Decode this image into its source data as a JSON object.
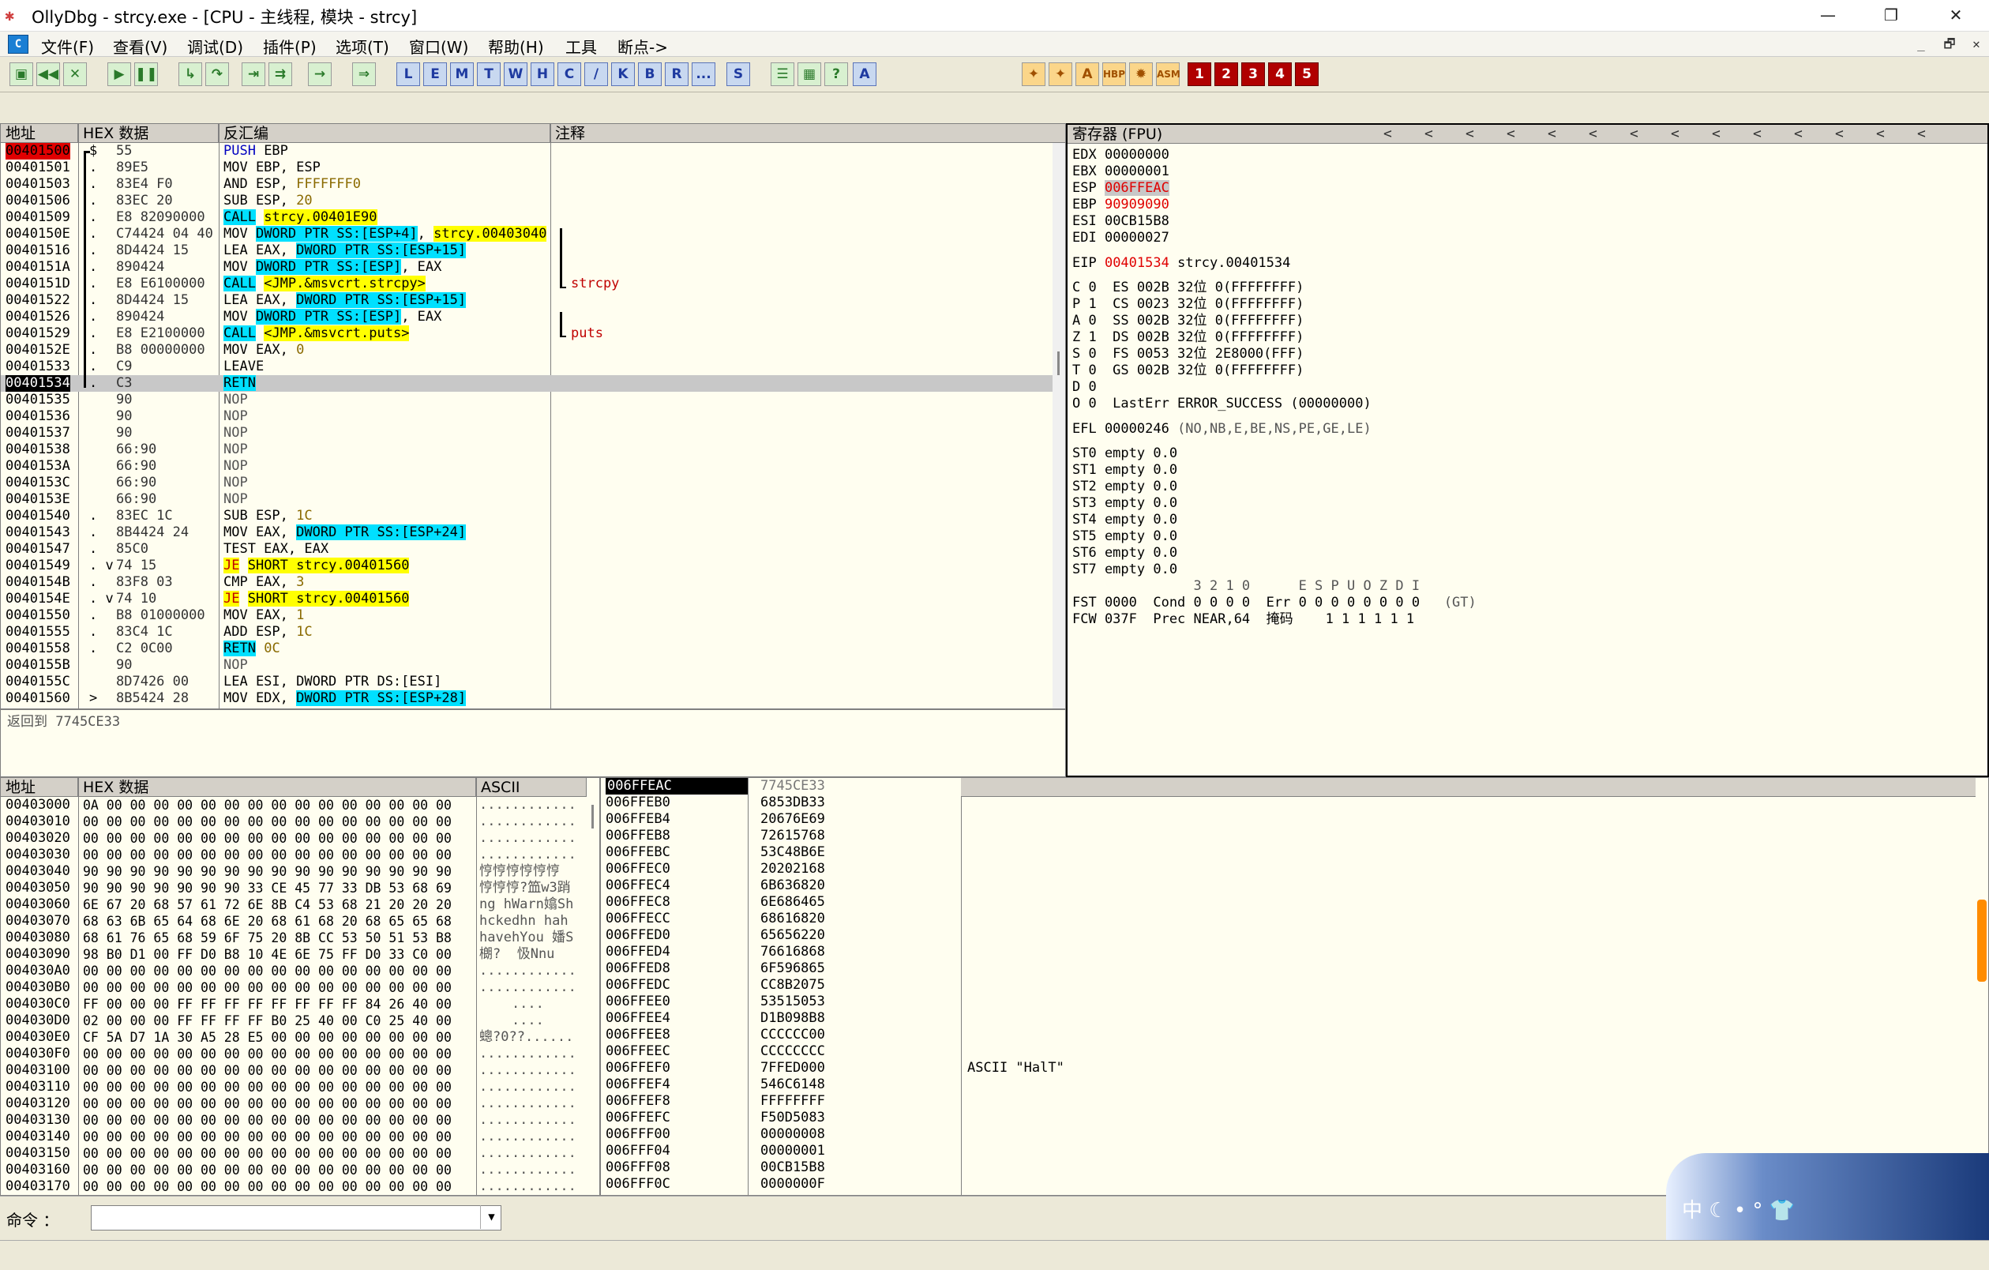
{
  "window": {
    "title": "OllyDbg - strcy.exe - [CPU -  主线程, 模块 - strcy]",
    "min_label": "—",
    "restore_label": "❐",
    "close_label": "✕"
  },
  "menu": {
    "icon": "C",
    "items": [
      "文件(F)",
      "查看(V)",
      "调试(D)",
      "插件(P)",
      "选项(T)",
      "窗口(W)",
      "帮助(H)",
      "工具",
      "断点->"
    ],
    "mdi_buttons": [
      "_",
      "🗗",
      "✕"
    ]
  },
  "toolbar": {
    "letters": [
      "L",
      "E",
      "M",
      "T",
      "W",
      "H",
      "C",
      "/",
      "K",
      "B",
      "R",
      "...",
      "S"
    ],
    "right_text": [
      "HBP",
      "ASM"
    ],
    "numbers": [
      "1",
      "2",
      "3",
      "4",
      "5"
    ]
  },
  "disasm": {
    "headers": {
      "addr": "地址",
      "hex": "HEX 数据",
      "disasm": "反汇编",
      "comment": "注释"
    },
    "rows": [
      {
        "addr": "00401500",
        "m": "$",
        "hex": "55",
        "asm": "PUSH EBP",
        "cmt": "",
        "style": "eipred"
      },
      {
        "addr": "00401501",
        "m": ".",
        "hex": "89E5",
        "asm": "MOV EBP, ESP",
        "cmt": ""
      },
      {
        "addr": "00401503",
        "m": ".",
        "hex": "83E4 F0",
        "asm": "AND ESP, FFFFFFF0",
        "cmt": ""
      },
      {
        "addr": "00401506",
        "m": ".",
        "hex": "83EC 20",
        "asm": "SUB ESP, 20",
        "cmt": ""
      },
      {
        "addr": "00401509",
        "m": ".",
        "hex": "E8 82090000",
        "asm": "CALL strcy.00401E90",
        "cmt": ""
      },
      {
        "addr": "0040150E",
        "m": ".",
        "hex": "C74424 04 40",
        "asm": "MOV DWORD PTR SS:[ESP+4], strcy.00403040",
        "cmt": ""
      },
      {
        "addr": "00401516",
        "m": ".",
        "hex": "8D4424 15",
        "asm": "LEA EAX, DWORD PTR SS:[ESP+15]",
        "cmt": ""
      },
      {
        "addr": "0040151A",
        "m": ".",
        "hex": "890424",
        "asm": "MOV DWORD PTR SS:[ESP], EAX",
        "cmt": ""
      },
      {
        "addr": "0040151D",
        "m": ".",
        "hex": "E8 E6100000",
        "asm": "CALL <JMP.&msvcrt.strcpy>",
        "cmt": "strcpy"
      },
      {
        "addr": "00401522",
        "m": ".",
        "hex": "8D4424 15",
        "asm": "LEA EAX, DWORD PTR SS:[ESP+15]",
        "cmt": ""
      },
      {
        "addr": "00401526",
        "m": ".",
        "hex": "890424",
        "asm": "MOV DWORD PTR SS:[ESP], EAX",
        "cmt": ""
      },
      {
        "addr": "00401529",
        "m": ".",
        "hex": "E8 E2100000",
        "asm": "CALL <JMP.&msvcrt.puts>",
        "cmt": "puts"
      },
      {
        "addr": "0040152E",
        "m": ".",
        "hex": "B8 00000000",
        "asm": "MOV EAX, 0",
        "cmt": ""
      },
      {
        "addr": "00401533",
        "m": ".",
        "hex": "C9",
        "asm": "LEAVE",
        "cmt": ""
      },
      {
        "addr": "00401534",
        "m": ".",
        "hex": "C3",
        "asm": "RETN",
        "cmt": "",
        "style": "cur"
      },
      {
        "addr": "00401535",
        "m": "",
        "hex": "90",
        "asm": "NOP",
        "cmt": ""
      },
      {
        "addr": "00401536",
        "m": "",
        "hex": "90",
        "asm": "NOP",
        "cmt": ""
      },
      {
        "addr": "00401537",
        "m": "",
        "hex": "90",
        "asm": "NOP",
        "cmt": ""
      },
      {
        "addr": "00401538",
        "m": "",
        "hex": "66:90",
        "asm": "NOP",
        "cmt": ""
      },
      {
        "addr": "0040153A",
        "m": "",
        "hex": "66:90",
        "asm": "NOP",
        "cmt": ""
      },
      {
        "addr": "0040153C",
        "m": "",
        "hex": "66:90",
        "asm": "NOP",
        "cmt": ""
      },
      {
        "addr": "0040153E",
        "m": "",
        "hex": "66:90",
        "asm": "NOP",
        "cmt": ""
      },
      {
        "addr": "00401540",
        "m": ".",
        "hex": "83EC 1C",
        "asm": "SUB ESP, 1C",
        "cmt": ""
      },
      {
        "addr": "00401543",
        "m": ".",
        "hex": "8B4424 24",
        "asm": "MOV EAX, DWORD PTR SS:[ESP+24]",
        "cmt": ""
      },
      {
        "addr": "00401547",
        "m": ".",
        "hex": "85C0",
        "asm": "TEST EAX, EAX",
        "cmt": ""
      },
      {
        "addr": "00401549",
        "m": ". v",
        "hex": "74 15",
        "asm": "JE SHORT strcy.00401560",
        "cmt": ""
      },
      {
        "addr": "0040154B",
        "m": ".",
        "hex": "83F8 03",
        "asm": "CMP EAX, 3",
        "cmt": ""
      },
      {
        "addr": "0040154E",
        "m": ". v",
        "hex": "74 10",
        "asm": "JE SHORT strcy.00401560",
        "cmt": ""
      },
      {
        "addr": "00401550",
        "m": ".",
        "hex": "B8 01000000",
        "asm": "MOV EAX, 1",
        "cmt": ""
      },
      {
        "addr": "00401555",
        "m": ".",
        "hex": "83C4 1C",
        "asm": "ADD ESP, 1C",
        "cmt": ""
      },
      {
        "addr": "00401558",
        "m": ".",
        "hex": "C2 0C00",
        "asm": "RETN 0C",
        "cmt": ""
      },
      {
        "addr": "0040155B",
        "m": "",
        "hex": "90",
        "asm": "NOP",
        "cmt": ""
      },
      {
        "addr": "0040155C",
        "m": "",
        "hex": "8D7426 00",
        "asm": "LEA ESI, DWORD PTR DS:[ESI]",
        "cmt": ""
      },
      {
        "addr": "00401560",
        "m": ">",
        "hex": "8B5424 28",
        "asm": "MOV EDX, DWORD PTR SS:[ESP+28]",
        "cmt": ""
      }
    ],
    "info": "返回到 7745CE33"
  },
  "registers": {
    "header": "寄存器 (FPU)",
    "arrows": [
      "<",
      "<",
      "<",
      "<",
      "<",
      "<",
      "<",
      "<",
      "<",
      "<",
      "<",
      "<",
      "<",
      "<"
    ],
    "gp": [
      {
        "name": "EDX",
        "val": "00000000",
        "extra": ""
      },
      {
        "name": "EBX",
        "val": "00000001",
        "extra": ""
      },
      {
        "name": "ESP",
        "val": "006FFEAC",
        "extra": "",
        "changed": true,
        "sel": true
      },
      {
        "name": "EBP",
        "val": "90909090",
        "extra": "",
        "changed": true
      },
      {
        "name": "ESI",
        "val": "00CB15B8",
        "extra": ""
      },
      {
        "name": "EDI",
        "val": "00000027",
        "extra": ""
      }
    ],
    "eip": {
      "name": "EIP",
      "val": "00401534",
      "extra": "strcy.00401534"
    },
    "flags": [
      "C 0  ES 002B 32位 0(FFFFFFFF)",
      "P 1  CS 0023 32位 0(FFFFFFFF)",
      "A 0  SS 002B 32位 0(FFFFFFFF)",
      "Z 1  DS 002B 32位 0(FFFFFFFF)",
      "S 0  FS 0053 32位 2E8000(FFF)",
      "T 0  GS 002B 32位 0(FFFFFFFF)",
      "D 0",
      "O 0  LastErr ERROR_SUCCESS (00000000)"
    ],
    "efl": {
      "label": "EFL 00000246",
      "extra": "(NO,NB,E,BE,NS,PE,GE,LE)"
    },
    "st": [
      "ST0 empty 0.0",
      "ST1 empty 0.0",
      "ST2 empty 0.0",
      "ST3 empty 0.0",
      "ST4 empty 0.0",
      "ST5 empty 0.0",
      "ST6 empty 0.0",
      "ST7 empty 0.0"
    ],
    "fpu_hdr": "               3 2 1 0      E S P U O Z D I",
    "fst": "FST 0000  Cond 0 0 0 0  Err 0 0 0 0 0 0 0 0",
    "fst_gt": "(GT)",
    "fcw": "FCW 037F  Prec NEAR,64  掩码    1 1 1 1 1 1"
  },
  "dump": {
    "headers": {
      "addr": "地址",
      "hex": "HEX 数据",
      "ascii": "ASCII"
    },
    "rows": [
      {
        "addr": "00403000",
        "hex": "0A 00 00 00 00 00 00 00 00 00 00 00 00 00 00 00",
        "ascii": "............"
      },
      {
        "addr": "00403010",
        "hex": "00 00 00 00 00 00 00 00 00 00 00 00 00 00 00 00",
        "ascii": "............"
      },
      {
        "addr": "00403020",
        "hex": "00 00 00 00 00 00 00 00 00 00 00 00 00 00 00 00",
        "ascii": "............"
      },
      {
        "addr": "00403030",
        "hex": "00 00 00 00 00 00 00 00 00 00 00 00 00 00 00 00",
        "ascii": "............"
      },
      {
        "addr": "00403040",
        "hex": "90 90 90 90 90 90 90 90 90 90 90 90 90 90 90 90",
        "ascii": "悙悙悙悙悙悙"
      },
      {
        "addr": "00403050",
        "hex": "90 90 90 90 90 90 90 33 CE 45 77 33 DB 53 68 69",
        "ascii": "悙悙悙?笽w3踃"
      },
      {
        "addr": "00403060",
        "hex": "6E 67 20 68 57 61 72 6E 8B C4 53 68 21 20 20 20",
        "ascii": "ng hWarn嬆Sh"
      },
      {
        "addr": "00403070",
        "hex": "68 63 6B 65 64 68 6E 20 68 61 68 20 68 65 65 68",
        "ascii": "hckedhn hah"
      },
      {
        "addr": "00403080",
        "hex": "68 61 76 65 68 59 6F 75 20 8B CC 53 50 51 53 B8",
        "ascii": "havehYou 嬏S"
      },
      {
        "addr": "00403090",
        "hex": "98 B0 D1 00 FF D0 B8 10 4E 6E 75 FF D0 33 C0 00",
        "ascii": "樃?  忣Nnu"
      },
      {
        "addr": "004030A0",
        "hex": "00 00 00 00 00 00 00 00 00 00 00 00 00 00 00 00",
        "ascii": "............"
      },
      {
        "addr": "004030B0",
        "hex": "00 00 00 00 00 00 00 00 00 00 00 00 00 00 00 00",
        "ascii": "............"
      },
      {
        "addr": "004030C0",
        "hex": "FF 00 00 00 FF FF FF FF FF FF FF FF 84 26 40 00",
        "ascii": "    ...."
      },
      {
        "addr": "004030D0",
        "hex": "02 00 00 00 FF FF FF FF B0 25 40 00 C0 25 40 00",
        "ascii": "    ...."
      },
      {
        "addr": "004030E0",
        "hex": "CF 5A D7 1A 30 A5 28 E5 00 00 00 00 00 00 00 00",
        "ascii": "蟌?0??......"
      },
      {
        "addr": "004030F0",
        "hex": "00 00 00 00 00 00 00 00 00 00 00 00 00 00 00 00",
        "ascii": "............"
      },
      {
        "addr": "00403100",
        "hex": "00 00 00 00 00 00 00 00 00 00 00 00 00 00 00 00",
        "ascii": "............"
      },
      {
        "addr": "00403110",
        "hex": "00 00 00 00 00 00 00 00 00 00 00 00 00 00 00 00",
        "ascii": "............"
      },
      {
        "addr": "00403120",
        "hex": "00 00 00 00 00 00 00 00 00 00 00 00 00 00 00 00",
        "ascii": "............"
      },
      {
        "addr": "00403130",
        "hex": "00 00 00 00 00 00 00 00 00 00 00 00 00 00 00 00",
        "ascii": "............"
      },
      {
        "addr": "00403140",
        "hex": "00 00 00 00 00 00 00 00 00 00 00 00 00 00 00 00",
        "ascii": "............"
      },
      {
        "addr": "00403150",
        "hex": "00 00 00 00 00 00 00 00 00 00 00 00 00 00 00 00",
        "ascii": "............"
      },
      {
        "addr": "00403160",
        "hex": "00 00 00 00 00 00 00 00 00 00 00 00 00 00 00 00",
        "ascii": "............"
      },
      {
        "addr": "00403170",
        "hex": "00 00 00 00 00 00 00 00 00 00 00 00 00 00 00 00",
        "ascii": "............"
      }
    ]
  },
  "stack": {
    "rows": [
      {
        "addr": "006FFEAC",
        "val": "7745CE33",
        "cmt": "",
        "sel": true
      },
      {
        "addr": "006FFEB0",
        "val": "6853DB33",
        "cmt": ""
      },
      {
        "addr": "006FFEB4",
        "val": "20676E69",
        "cmt": ""
      },
      {
        "addr": "006FFEB8",
        "val": "72615768",
        "cmt": ""
      },
      {
        "addr": "006FFEBC",
        "val": "53C48B6E",
        "cmt": ""
      },
      {
        "addr": "006FFEC0",
        "val": "20202168",
        "cmt": ""
      },
      {
        "addr": "006FFEC4",
        "val": "6B636820",
        "cmt": ""
      },
      {
        "addr": "006FFEC8",
        "val": "6E686465",
        "cmt": ""
      },
      {
        "addr": "006FFECC",
        "val": "68616820",
        "cmt": ""
      },
      {
        "addr": "006FFED0",
        "val": "65656220",
        "cmt": ""
      },
      {
        "addr": "006FFED4",
        "val": "76616868",
        "cmt": ""
      },
      {
        "addr": "006FFED8",
        "val": "6F596865",
        "cmt": ""
      },
      {
        "addr": "006FFEDC",
        "val": "CC8B2075",
        "cmt": ""
      },
      {
        "addr": "006FFEE0",
        "val": "53515053",
        "cmt": ""
      },
      {
        "addr": "006FFEE4",
        "val": "D1B098B8",
        "cmt": ""
      },
      {
        "addr": "006FFEE8",
        "val": "CCCCCC00",
        "cmt": ""
      },
      {
        "addr": "006FFEEC",
        "val": "CCCCCCCC",
        "cmt": ""
      },
      {
        "addr": "006FFEF0",
        "val": "7FFED000",
        "cmt": "ASCII \"HalT\""
      },
      {
        "addr": "006FFEF4",
        "val": "546C6148",
        "cmt": ""
      },
      {
        "addr": "006FFEF8",
        "val": "FFFFFFFF",
        "cmt": ""
      },
      {
        "addr": "006FFEFC",
        "val": "F50D5083",
        "cmt": ""
      },
      {
        "addr": "006FFF00",
        "val": "00000008",
        "cmt": ""
      },
      {
        "addr": "006FFF04",
        "val": "00000001",
        "cmt": ""
      },
      {
        "addr": "006FFF08",
        "val": "00CB15B8",
        "cmt": ""
      },
      {
        "addr": "006FFF0C",
        "val": "0000000F",
        "cmt": ""
      }
    ]
  },
  "command": {
    "label": "命令 ：",
    "value": ""
  },
  "widget": {
    "text": "中 ☾ • ° 👕"
  }
}
